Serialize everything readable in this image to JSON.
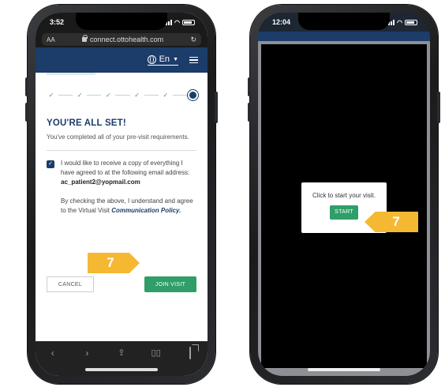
{
  "left_phone": {
    "status": {
      "time": "3:52"
    },
    "browser": {
      "text_size": "AA",
      "url": "connect.ottohealth.com",
      "reload_icon": "reload-icon"
    },
    "nav": {
      "language": "En"
    },
    "title": "YOU'RE ALL SET!",
    "subtitle": "You've completed all of your pre-visit requirements.",
    "consent": {
      "checked": true,
      "text": "I would like to receive a copy of everything I have agreed to at the following email address:",
      "email": "ac_patient2@yopmail.com"
    },
    "note": {
      "text": "By checking the above, I understand and agree to the Virtual Visit",
      "link": "Communication Policy."
    },
    "buttons": {
      "cancel": "CANCEL",
      "join": "JOIN VISIT"
    },
    "toolbar": {
      "back": "‹",
      "forward": "›",
      "share": "⇧",
      "bookmarks": "📖"
    }
  },
  "right_phone": {
    "status": {
      "time": "12:04"
    },
    "modal": {
      "text": "Click to start your visit.",
      "button": "START"
    }
  },
  "callouts": {
    "left": "7",
    "right": "7"
  },
  "colors": {
    "navy": "#1c3c69",
    "green": "#2f9e68",
    "callout": "#f5b833"
  }
}
